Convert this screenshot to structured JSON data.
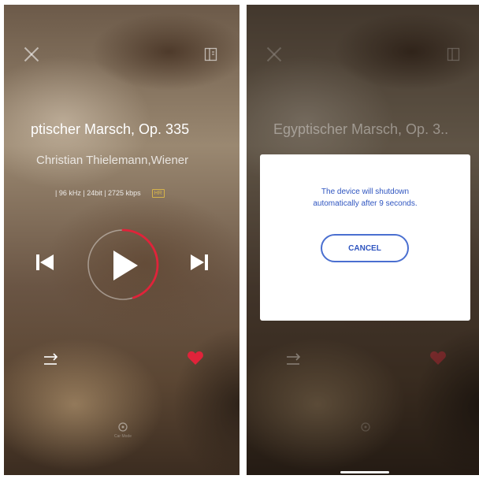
{
  "player_screen": {
    "track_title": "ptischer Marsch, Op. 335",
    "artist": "Christian Thielemann,Wiener",
    "quality": "| 96 kHz | 24bit | 2725 kbps",
    "quality_badge": "HR",
    "playback_progress": 0.45,
    "car_mode_label": "Car Mode",
    "accent_color": "#e0233a"
  },
  "shutdown_screen": {
    "track_title": "Egyptischer Marsch, Op. 3..",
    "dialog": {
      "message_line1": "The device will shutdown",
      "message_line2": "automatically after 9 seconds.",
      "cancel_label": "CANCEL"
    }
  }
}
